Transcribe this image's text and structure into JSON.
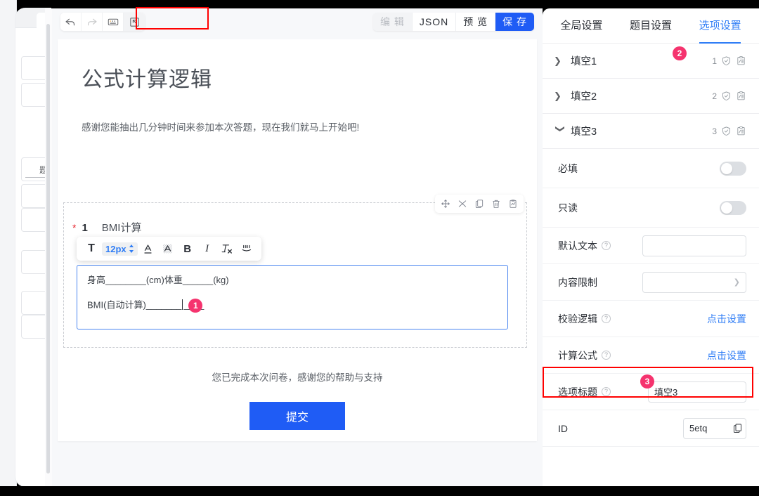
{
  "left_sidebar": {
    "clipped_item_label": "题",
    "items_count": 8
  },
  "editor_toolbar": {
    "undo_icon": "undo-arrow-icon",
    "redo_icon": "redo-arrow-icon",
    "keyboard_icon": "keyboard-icon",
    "import_icon": "import-arrow-icon",
    "modes": [
      {
        "label": "编 辑",
        "state": "disabled",
        "name": "mode-edit"
      },
      {
        "label": "JSON",
        "state": "normal",
        "name": "mode-json"
      },
      {
        "label": "预 览",
        "state": "normal",
        "name": "mode-preview"
      },
      {
        "label": "保 存",
        "state": "primary",
        "name": "mode-save"
      }
    ]
  },
  "survey": {
    "title": "公式计算逻辑",
    "subtitle": "感谢您能抽出几分钟时间来参加本次答题，现在我们就马上开始吧!",
    "question": {
      "required_mark": "*",
      "number": "1",
      "name": "BMI计算",
      "actions": [
        "move-icon",
        "shuffle-icon",
        "copy-icon",
        "delete-icon",
        "chart-icon"
      ],
      "rich_toolbar": {
        "text_icon": "T",
        "font_size": "12px",
        "stepper_icon": "updown-stepper-icon",
        "underline_icon": "A",
        "highlight_icon": "A",
        "bold_icon": "B",
        "italic_icon": "I",
        "clear_format_icon": "Tx",
        "quote_icon": "quote-icon"
      },
      "body_line_1": "身高________(cm)体重______(kg)",
      "body_line_2_prefix": "BMI(自动计算)_______",
      "body_line_2_suffix": "____",
      "inline_badge": "1"
    },
    "footer_text": "您已完成本次问卷，感谢您的帮助与支持",
    "submit_label": "提交"
  },
  "settings_panel": {
    "tabs": [
      {
        "label": "全局设置",
        "active": false,
        "name": "tab-global-settings"
      },
      {
        "label": "题目设置",
        "active": false,
        "name": "tab-question-settings"
      },
      {
        "label": "选项设置",
        "active": true,
        "name": "tab-option-settings"
      }
    ],
    "tab_badge": "2",
    "groups": [
      {
        "label": "填空1",
        "expanded": false,
        "count": "1",
        "icons": [
          "shield-check-icon",
          "formula-clipboard-icon"
        ]
      },
      {
        "label": "填空2",
        "expanded": false,
        "count": "2",
        "icons": [
          "shield-check-icon",
          "formula-clipboard-icon"
        ]
      },
      {
        "label": "填空3",
        "expanded": true,
        "count": "3",
        "icons": [
          "shield-check-icon",
          "formula-clipboard-icon"
        ]
      }
    ],
    "rows": {
      "required": {
        "label": "必填",
        "toggle": "off"
      },
      "readonly": {
        "label": "只读",
        "toggle": "off"
      },
      "default_text": {
        "label": "默认文本",
        "help": "?",
        "value": "",
        "placeholder": ""
      },
      "content_limit": {
        "label": "内容限制",
        "value": "",
        "caret": "chevron-down-icon"
      },
      "validate_logic": {
        "label": "校验逻辑",
        "help": "?",
        "action": "点击设置"
      },
      "formula": {
        "label": "计算公式",
        "help": "?",
        "action": "点击设置",
        "badge": "3",
        "highlighted": true
      },
      "option_title": {
        "label": "选项标题",
        "help": "?",
        "value": "填空3"
      },
      "id": {
        "label": "ID",
        "value": "5etq",
        "copy_icon": "copy-icon"
      }
    }
  },
  "colors": {
    "primary_blue": "#1f5cf5",
    "link_blue": "#2f7df6",
    "badge_pink": "#f5336e",
    "highlight_red": "#ff0000",
    "canvas_bg": "#f7f8fa"
  }
}
